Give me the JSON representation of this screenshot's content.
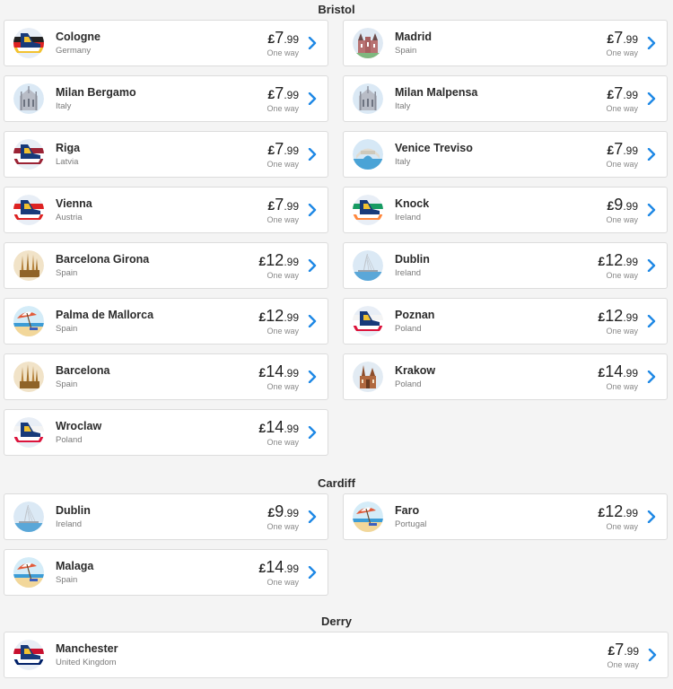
{
  "colors": {
    "chevron": "#1e88e5",
    "background": "#f4f4f4",
    "card": "#ffffff"
  },
  "sections": [
    {
      "title": "Bristol",
      "routes": [
        {
          "city": "Cologne",
          "country": "Germany",
          "currency": "£",
          "main": "7",
          "dec": ".99",
          "note": "One way",
          "icon": "plane-tail-germany-icon"
        },
        {
          "city": "Madrid",
          "country": "Spain",
          "currency": "£",
          "main": "7",
          "dec": ".99",
          "note": "One way",
          "icon": "madrid-palace-icon"
        },
        {
          "city": "Milan Bergamo",
          "country": "Italy",
          "currency": "£",
          "main": "7",
          "dec": ".99",
          "note": "One way",
          "icon": "milan-cathedral-icon"
        },
        {
          "city": "Milan Malpensa",
          "country": "Italy",
          "currency": "£",
          "main": "7",
          "dec": ".99",
          "note": "One way",
          "icon": "milan-cathedral-icon"
        },
        {
          "city": "Riga",
          "country": "Latvia",
          "currency": "£",
          "main": "7",
          "dec": ".99",
          "note": "One way",
          "icon": "plane-tail-latvia-icon"
        },
        {
          "city": "Venice Treviso",
          "country": "Italy",
          "currency": "£",
          "main": "7",
          "dec": ".99",
          "note": "One way",
          "icon": "venice-bridge-icon"
        },
        {
          "city": "Vienna",
          "country": "Austria",
          "currency": "£",
          "main": "7",
          "dec": ".99",
          "note": "One way",
          "icon": "plane-tail-austria-icon"
        },
        {
          "city": "Knock",
          "country": "Ireland",
          "currency": "£",
          "main": "9",
          "dec": ".99",
          "note": "One way",
          "icon": "plane-tail-ireland-icon"
        },
        {
          "city": "Barcelona Girona",
          "country": "Spain",
          "currency": "£",
          "main": "12",
          "dec": ".99",
          "note": "One way",
          "icon": "sagrada-familia-icon"
        },
        {
          "city": "Dublin",
          "country": "Ireland",
          "currency": "£",
          "main": "12",
          "dec": ".99",
          "note": "One way",
          "icon": "dublin-bridge-icon"
        },
        {
          "city": "Palma de Mallorca",
          "country": "Spain",
          "currency": "£",
          "main": "12",
          "dec": ".99",
          "note": "One way",
          "icon": "beach-umbrella-icon"
        },
        {
          "city": "Poznan",
          "country": "Poland",
          "currency": "£",
          "main": "12",
          "dec": ".99",
          "note": "One way",
          "icon": "plane-tail-poland-icon"
        },
        {
          "city": "Barcelona",
          "country": "Spain",
          "currency": "£",
          "main": "14",
          "dec": ".99",
          "note": "One way",
          "icon": "sagrada-familia-icon"
        },
        {
          "city": "Krakow",
          "country": "Poland",
          "currency": "£",
          "main": "14",
          "dec": ".99",
          "note": "One way",
          "icon": "krakow-church-icon"
        },
        {
          "city": "Wroclaw",
          "country": "Poland",
          "currency": "£",
          "main": "14",
          "dec": ".99",
          "note": "One way",
          "icon": "plane-tail-poland-icon"
        }
      ]
    },
    {
      "title": "Cardiff",
      "routes": [
        {
          "city": "Dublin",
          "country": "Ireland",
          "currency": "£",
          "main": "9",
          "dec": ".99",
          "note": "One way",
          "icon": "dublin-bridge-icon"
        },
        {
          "city": "Faro",
          "country": "Portugal",
          "currency": "£",
          "main": "12",
          "dec": ".99",
          "note": "One way",
          "icon": "beach-umbrella-icon"
        },
        {
          "city": "Malaga",
          "country": "Spain",
          "currency": "£",
          "main": "14",
          "dec": ".99",
          "note": "One way",
          "icon": "beach-umbrella-icon"
        }
      ]
    },
    {
      "title": "Derry",
      "routes": [
        {
          "city": "Manchester",
          "country": "United Kingdom",
          "currency": "£",
          "main": "7",
          "dec": ".99",
          "note": "One way",
          "icon": "plane-tail-uk-icon"
        }
      ]
    }
  ]
}
